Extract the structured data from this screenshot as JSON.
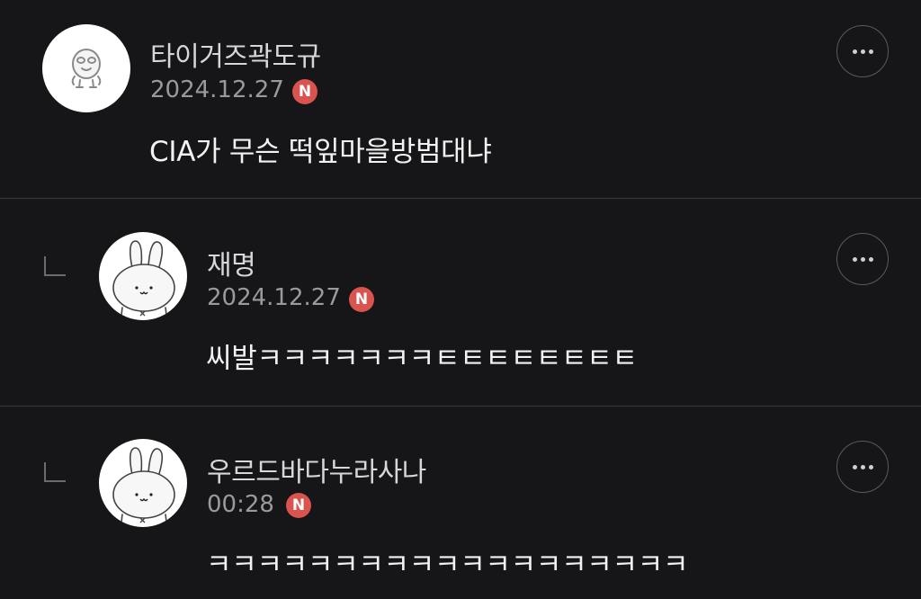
{
  "comments": [
    {
      "author": "타이거즈곽도규",
      "date": "2024.12.27",
      "badge": "N",
      "text": "CIA가 무슨 떡잎마을방범대냐",
      "avatar_icon": "duck-character-icon"
    },
    {
      "author": "재명",
      "date": "2024.12.27",
      "badge": "N",
      "text": "씨발ㅋㅋㅋㅋㅋㅋㅋㅌㅌㅌㅌㅌㅌㅌㅌ",
      "avatar_icon": "rabbit-character-icon"
    },
    {
      "author": "우르드바다누라사나",
      "date": "00:28",
      "badge": "N",
      "text": "ㅋㅋㅋㅋㅋㅋㅋㅋㅋㅋㅋㅋㅋㅋㅋㅋㅋㅋㅋ",
      "avatar_icon": "rabbit-character-icon"
    }
  ],
  "colors": {
    "background": "#161618",
    "badge": "#d9534f",
    "divider": "#38383b"
  }
}
